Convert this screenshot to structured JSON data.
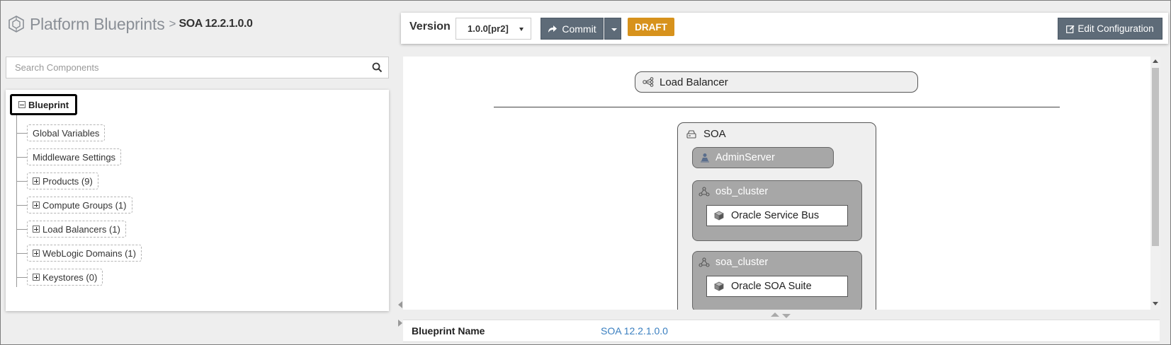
{
  "header": {
    "app_title": "Platform Blueprints",
    "separator": ">",
    "current": "SOA 12.2.1.0.0"
  },
  "search": {
    "placeholder": "Search Components",
    "value": ""
  },
  "tree": {
    "root": "Blueprint",
    "items": [
      {
        "label": "Global Variables",
        "expandable": false
      },
      {
        "label": "Middleware Settings",
        "expandable": false
      },
      {
        "label": "Products (9)",
        "expandable": true
      },
      {
        "label": "Compute Groups (1)",
        "expandable": true
      },
      {
        "label": "Load Balancers (1)",
        "expandable": true
      },
      {
        "label": "WebLogic Domains (1)",
        "expandable": true
      },
      {
        "label": "Keystores (0)",
        "expandable": true
      }
    ]
  },
  "toolbar": {
    "version_label": "Version",
    "version_selected": "1.0.0[pr2]",
    "commit_label": "Commit",
    "status_badge": "DRAFT",
    "edit_label": "Edit Configuration"
  },
  "canvas": {
    "load_balancer": "Load Balancer",
    "domain": "SOA",
    "admin_server": "AdminServer",
    "clusters": [
      {
        "name": "osb_cluster",
        "component": "Oracle Service Bus"
      },
      {
        "name": "soa_cluster",
        "component": "Oracle SOA Suite"
      }
    ]
  },
  "details": {
    "label": "Blueprint Name",
    "value": "SOA 12.2.1.0.0"
  },
  "colors": {
    "accent_button": "#5e6b78",
    "draft_badge": "#d7921c",
    "link": "#3a7fc0",
    "cluster_fill": "#a7a7a7"
  },
  "icons": {
    "logo": "blueprint-logo-icon",
    "search": "search-icon",
    "commit": "share-arrow-icon",
    "edit": "edit-icon",
    "load_balancer": "load-balancer-icon",
    "domain": "domain-icon",
    "server": "server-icon",
    "cluster": "cluster-icon",
    "component": "cube-icon"
  }
}
